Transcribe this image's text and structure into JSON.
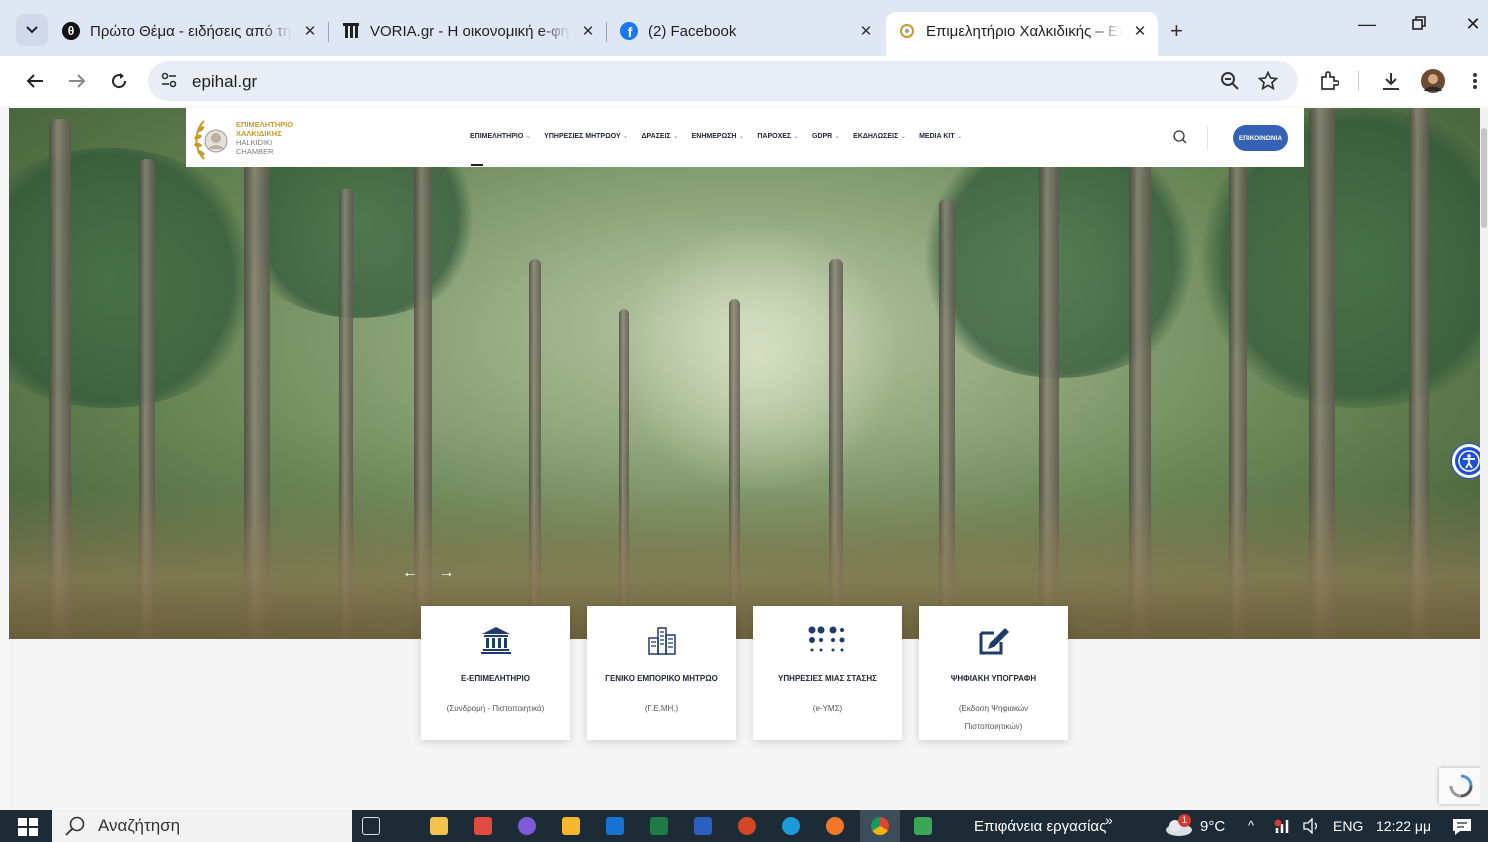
{
  "browser": {
    "tabs": [
      {
        "title": "Πρώτο Θέμα - ειδήσεις από τη",
        "favicon": "protothema-icon"
      },
      {
        "title": "VORIA.gr - Η οικονομική e-φημ",
        "favicon": "voria-icon"
      },
      {
        "title": "(2) Facebook",
        "favicon": "facebook-icon"
      },
      {
        "title": "Επιμελητήριο Χαλκιδικής – Επι",
        "favicon": "epihal-icon",
        "active": true
      }
    ],
    "url": "epihal.gr"
  },
  "site": {
    "logo": {
      "line1": "ΕΠΙΜΕΛΗΤΗΡΙΟ",
      "line2": "ΧΑΛΚΙΔΙΚΗΣ",
      "line3": "HALKIDIKI",
      "line4": "CHAMBER"
    },
    "menu": [
      "ΕΠΙΜΕΛΗΤΗΡΙΟ",
      "ΥΠΗΡΕΣΙΕΣ ΜΗΤΡΩΟΥ",
      "ΔΡΑΣΕΙΣ",
      "ΕΝΗΜΕΡΩΣΗ",
      "ΠΑΡΟΧΕΣ",
      "GDPR",
      "ΕΚΔΗΛΩΣΕΙΣ",
      "MEDIA KIT"
    ],
    "contact_label": "ΕΠΙΚΟΙΝΩΝΙΑ",
    "slider_prev": "←",
    "slider_next": "→",
    "cards": [
      {
        "title": "Ε-ΕΠΙΜΕΛΗΤΗΡΙΟ",
        "subtitle": "(Συνδρομή - Πιστοποιητικά)",
        "icon": "bank-icon"
      },
      {
        "title": "ΓΕΝΙΚΟ ΕΜΠΟΡΙΚΟ ΜΗΤΡΩΟ",
        "subtitle": "(Γ.Ε.ΜΗ.)",
        "icon": "buildings-icon"
      },
      {
        "title": "ΥΠΗΡΕΣΙΕΣ ΜΙΑΣ ΣΤΑΣΗΣ",
        "subtitle": "(e-ΥΜΣ)",
        "icon": "dots-grid-icon"
      },
      {
        "title": "ΨΗΦΙΑΚΗ ΥΠΟΓΡΑΦΗ",
        "subtitle": "(Εκδοση Ψηφιακών Πιστοποιητικών)",
        "icon": "edit-icon"
      }
    ],
    "accent": "#3561b6",
    "gold": "#c59a2a"
  },
  "taskbar": {
    "search_placeholder": "Αναζήτηση",
    "desktop_label": "Επιφάνεια εργασίας",
    "chevron": "»",
    "weather": "9°C",
    "weather_badge": "1",
    "language": "ENG",
    "time": "12:22 μμ"
  }
}
